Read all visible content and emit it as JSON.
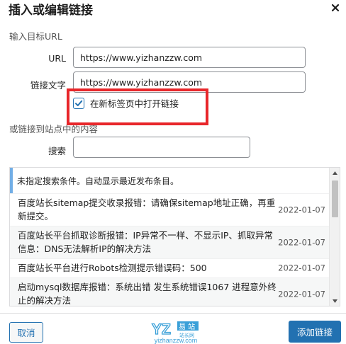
{
  "dialog": {
    "title": "插入或编辑链接",
    "close_icon": "close-icon"
  },
  "target_section": {
    "label": "输入目标URL",
    "url_label": "URL",
    "url_value": "https://www.yizhanzzw.com",
    "link_text_label": "链接文字",
    "link_text_value": "https://www.yizhanzzw.com",
    "new_tab_label": "在新标签页中打开链接",
    "new_tab_checked": true
  },
  "existing_content": {
    "label": "或链接到站点中的内容",
    "search_label": "搜索",
    "search_value": "",
    "notice": "未指定搜索条件。自动显示最近发布条目。",
    "results": [
      {
        "title": "百度站长sitemap提交收录报错：请确保sitemap地址正确，再重新提交。",
        "date": "2022-01-07"
      },
      {
        "title": "百度站长平台抓取诊断报错：IP异常不一样、不显示IP、抓取异常信息：DNS无法解析IP的解决方法",
        "date": "2022-01-07"
      },
      {
        "title": "百度站长平台进行Robots检测提示错误码：500",
        "date": "2022-01-07"
      },
      {
        "title": "启动mysql数据库报错：系统出错 发生系统错误1067 进程意外终止的解决方法",
        "date": "2022-01-07"
      }
    ]
  },
  "footer": {
    "cancel_label": "取消",
    "add_label": "添加链接"
  },
  "watermark": {
    "logo_letters": "YZ",
    "logo_cn_top": "易站",
    "logo_cn_bottom": "站长网",
    "url": "yizhanzzw.com"
  },
  "colors": {
    "accent": "#2271b1",
    "highlight_box": "#e8262a",
    "notice_border": "#72aee6"
  }
}
